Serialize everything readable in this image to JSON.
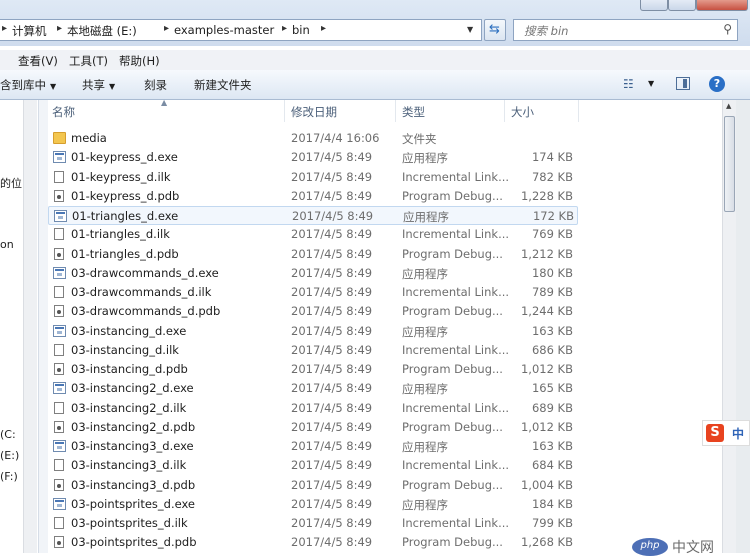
{
  "address": {
    "crumbs": [
      "计算机",
      "本地磁盘 (E:)",
      "examples-master",
      "bin"
    ]
  },
  "search": {
    "placeholder": "搜索 bin"
  },
  "menu": [
    "查看(V)",
    "工具(T)",
    "帮助(H)"
  ],
  "toolbar": {
    "include_label": "含到库中",
    "share_label": "共享",
    "burn_label": "刻录",
    "new_folder_label": "新建文件夹"
  },
  "navpane": {
    "fragments": [
      "的位",
      "on",
      "(C:",
      "(E:)",
      "(F:)"
    ]
  },
  "columns": {
    "name": "名称",
    "date": "修改日期",
    "type": "类型",
    "size": "大小"
  },
  "files": [
    {
      "name": "media",
      "date": "2017/4/4 16:06",
      "type": "文件夹",
      "size": "",
      "icon": "folder-icon"
    },
    {
      "name": "01-keypress_d.exe",
      "date": "2017/4/5 8:49",
      "type": "应用程序",
      "size": "174 KB",
      "icon": "exe-icon"
    },
    {
      "name": "01-keypress_d.ilk",
      "date": "2017/4/5 8:49",
      "type": "Incremental Link...",
      "size": "782 KB",
      "icon": "ilk-icon"
    },
    {
      "name": "01-keypress_d.pdb",
      "date": "2017/4/5 8:49",
      "type": "Program Debug...",
      "size": "1,228 KB",
      "icon": "pdb-icon"
    },
    {
      "name": "01-triangles_d.exe",
      "date": "2017/4/5 8:49",
      "type": "应用程序",
      "size": "172 KB",
      "icon": "exe-icon",
      "selected": true
    },
    {
      "name": "01-triangles_d.ilk",
      "date": "2017/4/5 8:49",
      "type": "Incremental Link...",
      "size": "769 KB",
      "icon": "ilk-icon"
    },
    {
      "name": "01-triangles_d.pdb",
      "date": "2017/4/5 8:49",
      "type": "Program Debug...",
      "size": "1,212 KB",
      "icon": "pdb-icon"
    },
    {
      "name": "03-drawcommands_d.exe",
      "date": "2017/4/5 8:49",
      "type": "应用程序",
      "size": "180 KB",
      "icon": "exe-icon"
    },
    {
      "name": "03-drawcommands_d.ilk",
      "date": "2017/4/5 8:49",
      "type": "Incremental Link...",
      "size": "789 KB",
      "icon": "ilk-icon"
    },
    {
      "name": "03-drawcommands_d.pdb",
      "date": "2017/4/5 8:49",
      "type": "Program Debug...",
      "size": "1,244 KB",
      "icon": "pdb-icon"
    },
    {
      "name": "03-instancing_d.exe",
      "date": "2017/4/5 8:49",
      "type": "应用程序",
      "size": "163 KB",
      "icon": "exe-icon"
    },
    {
      "name": "03-instancing_d.ilk",
      "date": "2017/4/5 8:49",
      "type": "Incremental Link...",
      "size": "686 KB",
      "icon": "ilk-icon"
    },
    {
      "name": "03-instancing_d.pdb",
      "date": "2017/4/5 8:49",
      "type": "Program Debug...",
      "size": "1,012 KB",
      "icon": "pdb-icon"
    },
    {
      "name": "03-instancing2_d.exe",
      "date": "2017/4/5 8:49",
      "type": "应用程序",
      "size": "165 KB",
      "icon": "exe-icon"
    },
    {
      "name": "03-instancing2_d.ilk",
      "date": "2017/4/5 8:49",
      "type": "Incremental Link...",
      "size": "689 KB",
      "icon": "ilk-icon"
    },
    {
      "name": "03-instancing2_d.pdb",
      "date": "2017/4/5 8:49",
      "type": "Program Debug...",
      "size": "1,012 KB",
      "icon": "pdb-icon"
    },
    {
      "name": "03-instancing3_d.exe",
      "date": "2017/4/5 8:49",
      "type": "应用程序",
      "size": "163 KB",
      "icon": "exe-icon"
    },
    {
      "name": "03-instancing3_d.ilk",
      "date": "2017/4/5 8:49",
      "type": "Incremental Link...",
      "size": "684 KB",
      "icon": "ilk-icon"
    },
    {
      "name": "03-instancing3_d.pdb",
      "date": "2017/4/5 8:49",
      "type": "Program Debug...",
      "size": "1,004 KB",
      "icon": "pdb-icon"
    },
    {
      "name": "03-pointsprites_d.exe",
      "date": "2017/4/5 8:49",
      "type": "应用程序",
      "size": "184 KB",
      "icon": "exe-icon"
    },
    {
      "name": "03-pointsprites_d.ilk",
      "date": "2017/4/5 8:49",
      "type": "Incremental Link...",
      "size": "799 KB",
      "icon": "ilk-icon"
    },
    {
      "name": "03-pointsprites_d.pdb",
      "date": "2017/4/5 8:49",
      "type": "Program Debug...",
      "size": "1,268 KB",
      "icon": "pdb-icon"
    }
  ],
  "ime": {
    "logo": "S",
    "label": "中"
  },
  "watermark": {
    "badge": "php",
    "text": "中文网"
  },
  "colors": {
    "accent": "#2a6fc6",
    "selection": "#c2d8f0",
    "folder": "#f3c64f"
  }
}
